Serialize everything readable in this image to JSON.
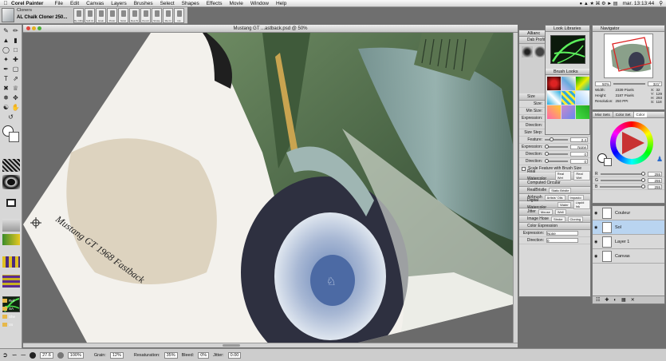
{
  "menubar": {
    "app_name": "Corel Painter",
    "items": [
      "File",
      "Edit",
      "Canvas",
      "Layers",
      "Brushes",
      "Select",
      "Shapes",
      "Effects",
      "Movie",
      "Window",
      "Help"
    ],
    "clock": "mar. 13:13:44"
  },
  "property_bar": {
    "brush_category": "Cloners",
    "brush_variant": "AL Chalk Cloner 250...",
    "thumbnails": [
      "Re ClPe",
      "Soft Cl",
      "Grain",
      "Pinstr",
      "Scrat",
      "Rea W",
      "Pencil",
      "Stroke",
      "Ma Cl",
      "Ink",
      "Thick",
      "Thick"
    ]
  },
  "document": {
    "title": "Mustang GT ...astback.psd @ 50%",
    "signature": "Mustang GT 1968 Fastback"
  },
  "statusbar": {
    "size_value": "27.6",
    "opacity_value": "100%",
    "grain_label": "Grain:",
    "grain_value": "12%",
    "resat_label": "Resaturation:",
    "resat_value": "35%",
    "bleed_label": "Bleed:",
    "bleed_value": "0%",
    "jitter_label": "Jitter:",
    "jitter_value": "0.00"
  },
  "side_folders": [
    "Ref",
    "SA",
    "She",
    "Vo"
  ],
  "brush_panel": {
    "title": "Allianc",
    "dab_profile": "Dab Profile",
    "size_section": "Size",
    "size_rows": [
      {
        "label": "Size:",
        "value": "27.6",
        "level": 0.35
      },
      {
        "label": "Min Size:",
        "value": "54%",
        "level": 0.54
      },
      {
        "label": "Expression:",
        "value": "Pressure",
        "level": 0
      },
      {
        "label": "Direction:",
        "value": "0",
        "level": 0
      },
      {
        "label": "Size Step:",
        "value": "5%",
        "level": 0.05
      },
      {
        "label": "Feature:",
        "value": "2.4",
        "level": 0.2
      },
      {
        "label": "Expression:",
        "value": "None",
        "level": 0
      },
      {
        "label": "Direction:",
        "value": "0",
        "level": 0
      },
      {
        "label": "Direction:",
        "value": "0",
        "level": 0
      }
    ],
    "checkbox_label": "Scale Feature with Brush Size",
    "sections": [
      {
        "name": "Real Watercolor",
        "chips": [
          "Real Wet",
          "Real Wet"
        ]
      },
      {
        "name": "Computed Circular",
        "chips": []
      },
      {
        "name": "RealBristle",
        "chips": [
          "Static Bristle"
        ]
      },
      {
        "name": "Airbrush",
        "chips": [
          "Artists' Oils",
          "Impasto"
        ]
      },
      {
        "name": "Digital Watercolor",
        "chips": [
          "Water",
          "Liquid Ink"
        ]
      },
      {
        "name": "Jitter",
        "chips": [
          "Mouse",
          "Well"
        ]
      },
      {
        "name": "Image Hose",
        "chips": [
          "Stroke",
          "Cloning"
        ]
      },
      {
        "name": "Color Expression",
        "chips": []
      }
    ],
    "color_expression_rows": [
      {
        "label": "Expression:",
        "value": "None"
      },
      {
        "label": "Direction:",
        "value": "0"
      }
    ]
  },
  "looks_panel": {
    "title": "Look Libraries",
    "brush_looks": "Brush Looks"
  },
  "navigator": {
    "title": "Navigator",
    "zoom": "50%",
    "angle": "321°",
    "width_label": "Width:",
    "width": "2339 Pixels",
    "height_label": "Height:",
    "height": "3187 Pixels",
    "res_label": "Resolution:",
    "res": "250 PPI",
    "coords": [
      {
        "k": "X:",
        "v": "32"
      },
      {
        "k": "Y:",
        "v": "129"
      },
      {
        "k": "H:",
        "v": "293"
      },
      {
        "k": "S:",
        "v": "118"
      }
    ]
  },
  "color_panel": {
    "tabs": [
      "Mixr Sets",
      "Color Set",
      "Color"
    ],
    "rgb": [
      {
        "k": "R",
        "v": "255"
      },
      {
        "k": "G",
        "v": "255"
      },
      {
        "k": "B",
        "v": "255"
      }
    ]
  },
  "layers_panel": {
    "layers": [
      "Couleur",
      "Sol",
      "Layer 1",
      "Canvas"
    ],
    "selected": "Sol"
  },
  "colors": {
    "car_green": "#4f6a47",
    "selected_layer": "#b9d4f0",
    "hue_ring": "#c83232"
  }
}
